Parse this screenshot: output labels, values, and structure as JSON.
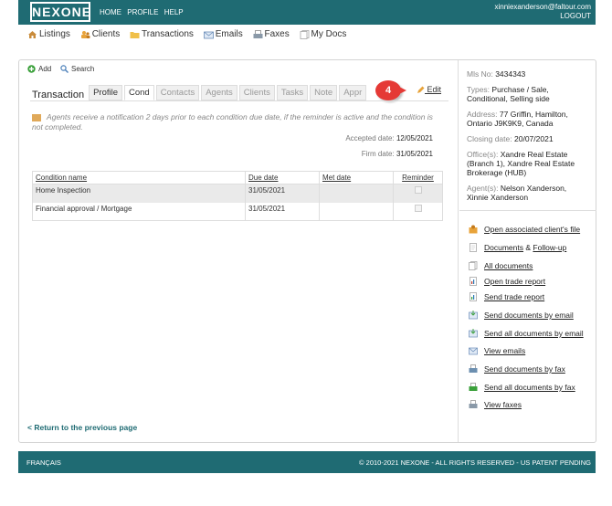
{
  "header": {
    "logo": "NEXONE",
    "nav": [
      "HOME",
      "PROFILE",
      "HELP"
    ],
    "user_email": "xinniexanderson@faltour.com",
    "logout": "LOGOUT"
  },
  "main_nav": [
    {
      "label": "Listings",
      "icon": "house-icon"
    },
    {
      "label": "Clients",
      "icon": "people-icon"
    },
    {
      "label": "Transactions",
      "icon": "folder-icon"
    },
    {
      "label": "Emails",
      "icon": "envelope-icon"
    },
    {
      "label": "Faxes",
      "icon": "fax-icon"
    },
    {
      "label": "My Docs",
      "icon": "docs-icon"
    }
  ],
  "toolbar": {
    "add": "Add",
    "search": "Search"
  },
  "tabs": {
    "title": "Transaction",
    "items": [
      "Profile",
      "Cond",
      "Contacts",
      "Agents",
      "Clients",
      "Tasks",
      "Note",
      "Appr"
    ],
    "active": "Cond"
  },
  "step_badge": "4",
  "edit_label": "Edit",
  "notice": "Agents receive a notification 2 days prior to each condition due date, if the reminder is active and the condition is not completed.",
  "dates": {
    "accepted_label": "Accepted date:",
    "accepted_value": "12/05/2021",
    "firm_label": "Firm date:",
    "firm_value": "31/05/2021"
  },
  "conditions": {
    "headers": [
      "Condition name",
      "Due date",
      "Met date",
      "Reminder"
    ],
    "rows": [
      {
        "name": "Home Inspection",
        "due": "31/05/2021",
        "met": "",
        "reminder": true
      },
      {
        "name": "Financial approval / Mortgage",
        "due": "31/05/2021",
        "met": "",
        "reminder": true
      }
    ]
  },
  "back_link": "< Return to the previous page",
  "sidebar": {
    "mls_label": "Mls No:",
    "mls_value": "3434343",
    "types_label": "Types:",
    "types_value": "Purchase / Sale, Conditional, Selling side",
    "address_label": "Address:",
    "address_value": "77 Griffin, Hamilton, Ontario J9K9K9, Canada",
    "closing_label": "Closing date:",
    "closing_value": "20/07/2021",
    "office_label": "Office(s):",
    "office_value": "Xandre Real Estate (Branch 1), Xandre Real Estate Brokerage (HUB)",
    "agents_label": "Agent(s):",
    "agents_value": "Nelson Xanderson, Xinnie Xanderson"
  },
  "actions": {
    "open_client_file": "Open associated client's file",
    "documents": "Documents",
    "amp": "&",
    "follow_up": "Follow-up",
    "all_documents": "All documents",
    "open_trade_report": "Open trade report",
    "send_trade_report": "Send trade report",
    "send_docs_email": "Send documents by email",
    "send_all_docs_email": "Send all documents by email",
    "view_emails": "View emails",
    "send_docs_fax": "Send documents by fax",
    "send_all_docs_fax": "Send all documents by fax",
    "view_faxes": "View faxes"
  },
  "footer": {
    "language": "FRANÇAIS",
    "copyright": "© 2010-2021 NEXONE - ALL RIGHTS RESERVED - US PATENT PENDING"
  },
  "colors": {
    "brand": "#1f6b73",
    "badge": "#e53935"
  }
}
